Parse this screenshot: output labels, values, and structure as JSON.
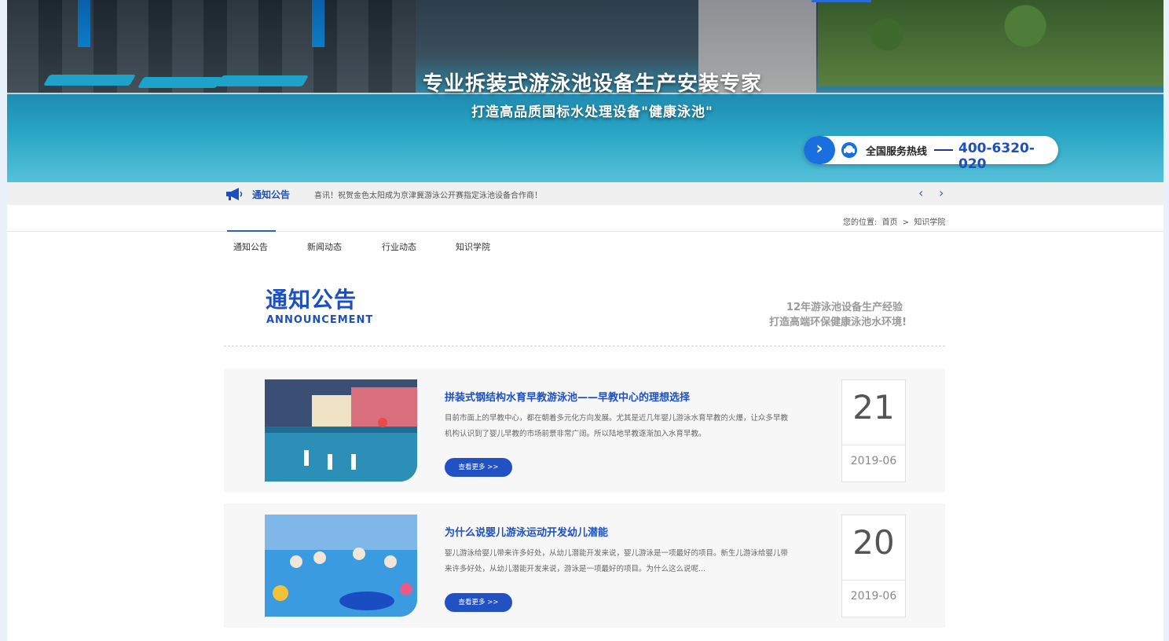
{
  "banner": {
    "headline": "专业拆装式游泳池设备生产安装专家",
    "subline": "打造高品质国标水处理设备\"健康泳池\"",
    "hotline_label": "全国服务热线",
    "hotline_number": "400-6320-020"
  },
  "notice_bar": {
    "title": "通知公告",
    "text": "喜讯！祝贺金色太阳成为京津冀游泳公开赛指定泳池设备合作商！",
    "prev_icon": "‹",
    "next_icon": "›"
  },
  "breadcrumb": {
    "prefix": "您的位置:",
    "home": "首页",
    "separator": ">",
    "current": "知识学院"
  },
  "tabs": [
    {
      "label": "通知公告",
      "active": true
    },
    {
      "label": "新闻动态",
      "active": false
    },
    {
      "label": "行业动态",
      "active": false
    },
    {
      "label": "知识学院",
      "active": false
    }
  ],
  "section": {
    "title_cn": "通知公告",
    "title_en": "ANNOUNCEMENT",
    "slogan_line1": "12年游泳池设备生产经验",
    "slogan_line2": "打造高端环保健康泳池水环境!"
  },
  "news": [
    {
      "title": "拼装式钢结构水育早教游泳池——早教中心的理想选择",
      "desc": "目前市面上的早教中心，都在朝着多元化方向发展。尤其是近几年婴儿游泳水育早教的火爆，让众多早教机构认识到了婴儿早教的市场前景非常广阔。所以陆地早教逐渐加入水育早教。",
      "more": "查看更多 >>",
      "day": "21",
      "year_month": "2019-06"
    },
    {
      "title": "为什么说婴儿游泳运动开发幼儿潜能",
      "desc": "婴儿游泳给婴儿带来许多好处，从幼儿潜能开发来说，婴儿游泳是一项最好的项目。新生儿游泳给婴儿带来许多好处，从幼儿潜能开发来说，游泳是一项最好的项目。为什么这么说呢...",
      "more": "查看更多 >>",
      "day": "20",
      "year_month": "2019-06"
    }
  ],
  "colors": {
    "brand_blue": "#1d4fbf",
    "button_blue": "#2251c4",
    "hotline_circle": "#1a6fe0"
  }
}
